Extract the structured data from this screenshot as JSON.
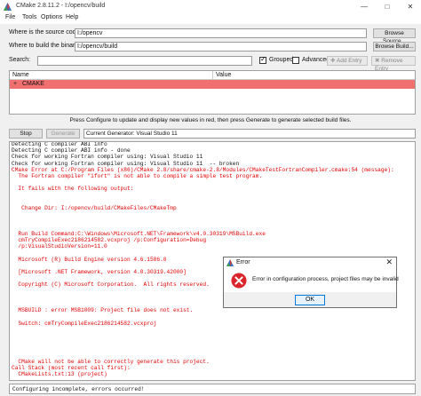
{
  "window": {
    "title": "CMake 2.8.11.2 - I:/opencv/build",
    "minimize_glyph": "—",
    "maximize_glyph": "□",
    "close_glyph": "✕"
  },
  "menu": [
    "File",
    "Tools",
    "Options",
    "Help"
  ],
  "source": {
    "label": "Where is the source code:",
    "value": "I:/opencv",
    "browse": "Browse Source..."
  },
  "binaries": {
    "label": "Where to build the binaries:",
    "value": "I:/opencv/build",
    "browse": "Browse Build..."
  },
  "search": {
    "label": "Search:",
    "value": ""
  },
  "options": {
    "grouped": {
      "label": "Grouped",
      "checked": true
    },
    "advanced": {
      "label": "Advanced",
      "checked": false
    },
    "add_entry": "Add Entry",
    "remove_entry": "Remove Entry"
  },
  "table": {
    "columns": [
      "Name",
      "Value"
    ],
    "rows": [
      {
        "expander": "+",
        "name": "CMAKE",
        "value": ""
      }
    ]
  },
  "hint": "Press Configure to update and display new values in red, then press Generate to generate selected build files.",
  "controls": {
    "stop": "Stop",
    "generate": "Generate",
    "generator": "Current Generator: Visual Studio 11"
  },
  "output_lines": [
    {
      "text": "Detecting C compiler ABI info",
      "color": "black"
    },
    {
      "text": "Detecting C compiler ABI info - done",
      "color": "black"
    },
    {
      "text": "Check for working Fortran compiler using: Visual Studio 11",
      "color": "black"
    },
    {
      "text": "Check for working Fortran compiler using: Visual Studio 11  -- broken",
      "color": "black"
    },
    {
      "text": "CMake Error at C:/Program Files (x86)/CMake 2.8/share/cmake-2.8/Modules/CMakeTestFortranCompiler.cmake:54 (message):",
      "color": "red"
    },
    {
      "text": "  The Fortran compiler \"ifort\" is not able to compile a simple test program.",
      "color": "red"
    },
    {
      "text": "",
      "color": "red"
    },
    {
      "text": "  It fails with the following output:",
      "color": "red"
    },
    {
      "text": "",
      "color": "red"
    },
    {
      "text": "",
      "color": "red"
    },
    {
      "text": "   Change Dir: I:/opencv/build/CMakeFiles/CMakeTmp",
      "color": "red"
    },
    {
      "text": "",
      "color": "red"
    },
    {
      "text": "",
      "color": "red"
    },
    {
      "text": "",
      "color": "red"
    },
    {
      "text": "  Run Build Command:C:\\Windows\\Microsoft.NET\\Framework\\v4.0.30319\\MSBuild.exe",
      "color": "red"
    },
    {
      "text": "  cmTryCompileExec2186214582.vcxproj /p:Configuration=Debug",
      "color": "red"
    },
    {
      "text": "  /p:VisualStudioVersion=11.0",
      "color": "red"
    },
    {
      "text": "",
      "color": "red"
    },
    {
      "text": "  Microsoft (R) Build Engine version 4.6.1586.0",
      "color": "red"
    },
    {
      "text": "",
      "color": "red"
    },
    {
      "text": "  [Microsoft .NET Framework, version 4.0.30319.42000]",
      "color": "red"
    },
    {
      "text": "",
      "color": "red"
    },
    {
      "text": "  Copyright (C) Microsoft Corporation.  All rights reserved.",
      "color": "red"
    },
    {
      "text": "",
      "color": "red"
    },
    {
      "text": "",
      "color": "red"
    },
    {
      "text": "",
      "color": "red"
    },
    {
      "text": "  MSBUILD : error MSB1009: Project file does not exist.",
      "color": "red"
    },
    {
      "text": "",
      "color": "red"
    },
    {
      "text": "  Switch: cmTryCompileExec2186214582.vcxproj",
      "color": "red"
    },
    {
      "text": "",
      "color": "red"
    },
    {
      "text": "",
      "color": "red"
    },
    {
      "text": "",
      "color": "red"
    },
    {
      "text": "",
      "color": "red"
    },
    {
      "text": "",
      "color": "red"
    },
    {
      "text": "  CMake will not be able to correctly generate this project.",
      "color": "red"
    },
    {
      "text": "Call Stack (most recent call first):",
      "color": "red"
    },
    {
      "text": "  CMakeLists.txt:13 (project)",
      "color": "red"
    }
  ],
  "status_line": "Configuring incomplete, errors occurred!",
  "dialog": {
    "title": "Error",
    "message": "Error in configuration process, project files may be invalid",
    "ok": "OK",
    "close_glyph": "✕"
  },
  "colors": {
    "row_highlight": "#f07070",
    "error_text": "#e00000",
    "error_icon": "#d9262c",
    "dialog_button_border": "#0078d7"
  },
  "icons": {
    "app": "cmake-triangle-icon",
    "error": "error-circle-x-icon",
    "add": "plus-icon",
    "remove": "x-icon"
  }
}
